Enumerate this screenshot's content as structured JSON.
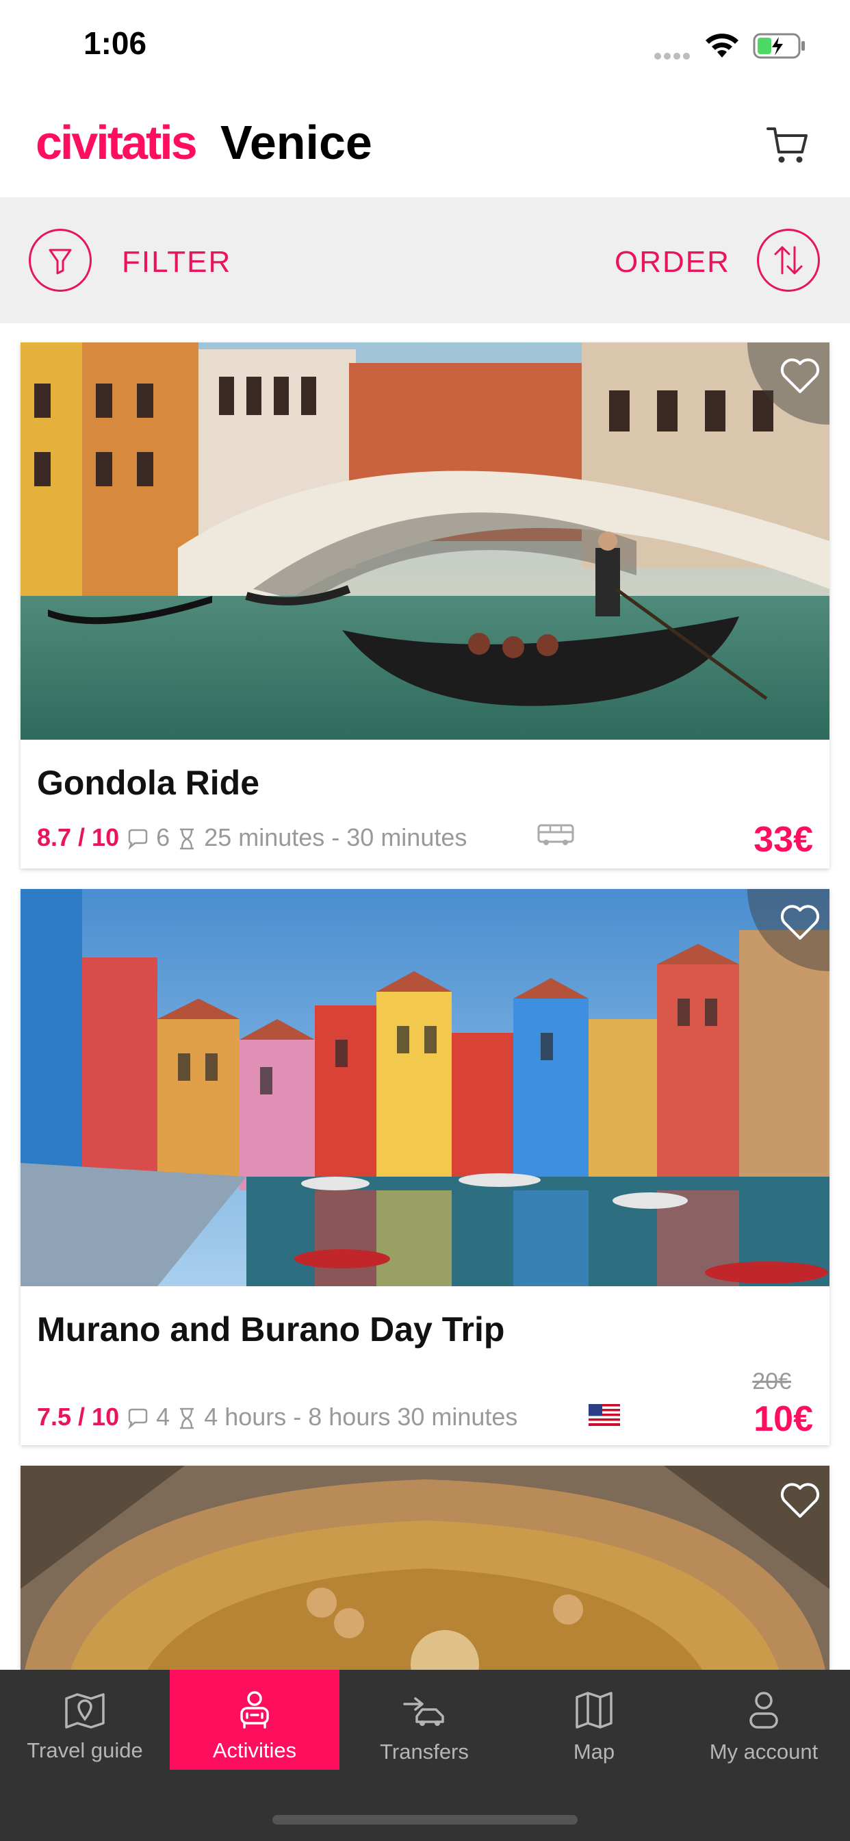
{
  "status_bar": {
    "time": "1:06"
  },
  "header": {
    "logo": "civitatis",
    "city": "Venice"
  },
  "toolbar": {
    "filter_label": "FILTER",
    "order_label": "ORDER"
  },
  "activities": [
    {
      "title": "Gondola Ride",
      "rating": "8.7 / 10",
      "reviews": "6",
      "duration": "25 minutes - 30 minutes",
      "price": "33€",
      "badge_icon": "bus-icon"
    },
    {
      "title": "Murano and Burano Day Trip",
      "rating": "7.5 / 10",
      "reviews": "4",
      "duration": "4 hours - 8 hours 30 minutes",
      "old_price": "20€",
      "price": "10€",
      "badge_icon": "us-flag-icon"
    }
  ],
  "tabs": [
    {
      "label": "Travel guide",
      "icon": "map-pin-icon",
      "active": false
    },
    {
      "label": "Activities",
      "icon": "activities-icon",
      "active": true
    },
    {
      "label": "Transfers",
      "icon": "transfer-car-icon",
      "active": false
    },
    {
      "label": "Map",
      "icon": "map-icon",
      "active": false
    },
    {
      "label": "My account",
      "icon": "user-icon",
      "active": false
    }
  ],
  "colors": {
    "brand": "#ff0e5e",
    "accent": "#e8145c",
    "tabbar": "#333333"
  }
}
